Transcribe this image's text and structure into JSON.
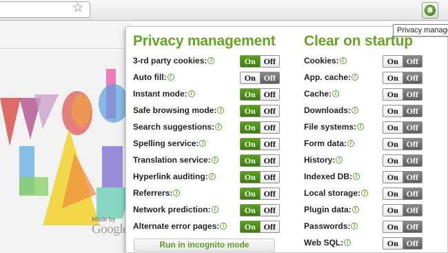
{
  "browser": {
    "star_glyph": "☆",
    "extension_icon": "privacy-extension-icon",
    "tooltip": "Privacy management"
  },
  "page": {
    "made_by": "Made by",
    "logo_text": "Google"
  },
  "popup": {
    "privacy_title": "Privacy management",
    "startup_title": "Clear on startup",
    "on_label": "On",
    "off_label": "Off",
    "privacy_items": [
      {
        "label": "3-rd party cookies:",
        "state": "on"
      },
      {
        "label": "Auto fill:",
        "state": "off"
      },
      {
        "label": "Instant mode:",
        "state": "on"
      },
      {
        "label": "Safe browsing mode:",
        "state": "on"
      },
      {
        "label": "Search suggestions:",
        "state": "on"
      },
      {
        "label": "Spelling service:",
        "state": "on"
      },
      {
        "label": "Translation service:",
        "state": "on"
      },
      {
        "label": "Hyperlink auditing:",
        "state": "on"
      },
      {
        "label": "Referrers:",
        "state": "on"
      },
      {
        "label": "Network prediction:",
        "state": "on"
      },
      {
        "label": "Alternate error pages:",
        "state": "on"
      }
    ],
    "startup_items": [
      {
        "label": "Cookies:",
        "state": "off"
      },
      {
        "label": "App. cache:",
        "state": "off"
      },
      {
        "label": "Cache:",
        "state": "off"
      },
      {
        "label": "Downloads:",
        "state": "off"
      },
      {
        "label": "File systems:",
        "state": "off"
      },
      {
        "label": "Form data:",
        "state": "off"
      },
      {
        "label": "History:",
        "state": "off"
      },
      {
        "label": "Indexed DB:",
        "state": "off"
      },
      {
        "label": "Local storage:",
        "state": "off"
      },
      {
        "label": "Plugin data:",
        "state": "off"
      },
      {
        "label": "Passwords:",
        "state": "off"
      },
      {
        "label": "Web SQL:",
        "state": "off"
      }
    ],
    "incognito_button": "Run in incognito mode"
  },
  "colors": {
    "accent_green": "#66a225",
    "toggle_on": "#4a9211",
    "toggle_off": "#6e6e6e"
  }
}
